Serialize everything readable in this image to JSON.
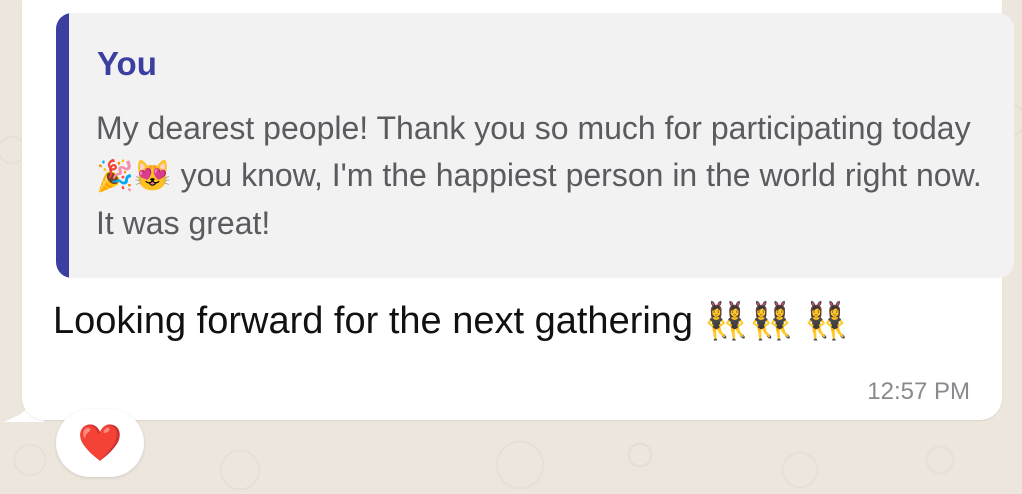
{
  "quote": {
    "author": "You",
    "text_part1": "My dearest people! Thank you so much for participating today ",
    "emoji_party": "🎉",
    "emoji_cat": "😻",
    "text_part2": " you know, I'm the happiest person in the world right now. It was great!"
  },
  "message": {
    "text": "Looking forward for the next gathering ",
    "emojis": "👯‍♀️👯‍♀️ 👯‍♀️"
  },
  "timestamp": "12:57 PM",
  "reaction": {
    "emoji": "❤️",
    "icon": "heart-icon"
  },
  "colors": {
    "quote_accent": "#3b40a0",
    "wallpaper": "#ece6dd",
    "bubble": "#ffffff"
  }
}
